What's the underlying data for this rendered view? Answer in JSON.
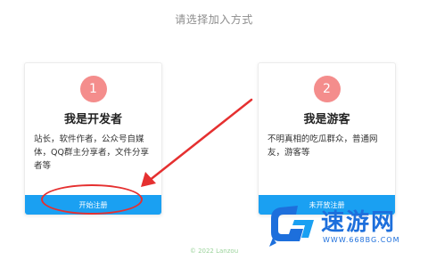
{
  "header": {
    "title": "请选择加入方式"
  },
  "cards": [
    {
      "step": "1",
      "title": "我是开发者",
      "description": "站长，软件作者，公众号自媒体，QQ群主分享者，文件分享者等",
      "button_label": "开始注册"
    },
    {
      "step": "2",
      "title": "我是游客",
      "description": "不明真相的吃瓜群众，普通网友，游客等",
      "button_label": "未开放注册"
    }
  ],
  "footer": {
    "copyright": "© 2022 Lanzou"
  },
  "watermark": {
    "brand": "速游网",
    "url": "WWW.668BG.COM"
  },
  "colors": {
    "accent": "#1aa0f2",
    "step_circle": "#f48d8c",
    "annotation": "#e53030"
  }
}
